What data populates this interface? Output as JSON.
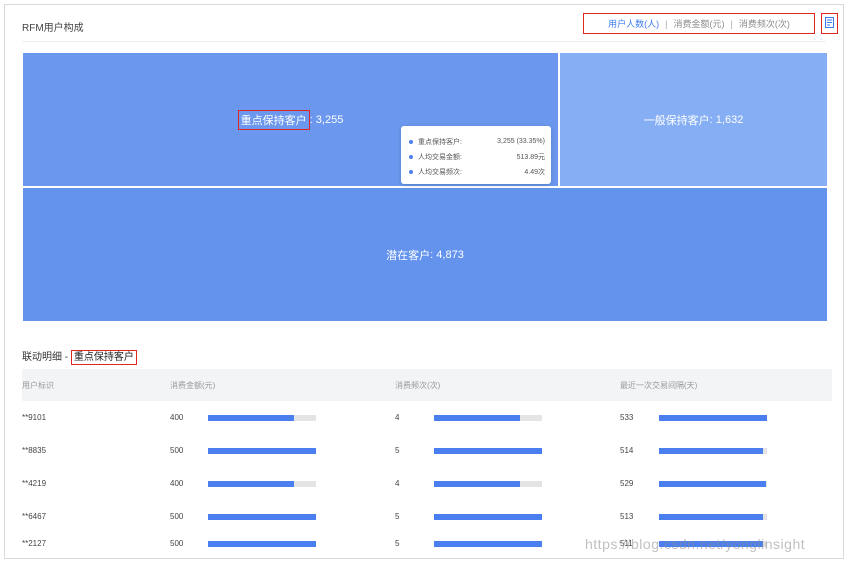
{
  "panel": {
    "title": "RFM用户构成",
    "metrics": [
      "用户人数(人)",
      "消费金额(元)",
      "消费频次(次)"
    ],
    "separator": "|",
    "active_metric_index": 0
  },
  "treemap": {
    "segments": [
      {
        "name": "重点保持客户",
        "value_text": ": 3,255",
        "value": 3255,
        "color": "#6b98ee"
      },
      {
        "name": "一般保持客户",
        "value_text": ": 1,632",
        "value": 1632,
        "color": "#85aef5"
      },
      {
        "name": "潜在客户",
        "value_text": ": 4,873",
        "value": 4873,
        "color": "#6393ed"
      }
    ],
    "tooltip": [
      {
        "key": "重点保持客户:",
        "val": "3,255 (33.35%)"
      },
      {
        "key": "人均交易金额:",
        "val": "513.89元"
      },
      {
        "key": "人均交易频次:",
        "val": "4.49次"
      }
    ]
  },
  "detail": {
    "prefix": "联动明细 - ",
    "segment": "重点保持客户",
    "columns": [
      "用户标识",
      "消费金额(元)",
      "消费频次(次)",
      "最近一次交易间隔(天)"
    ],
    "rows": [
      {
        "id": "**9101",
        "amount": "400",
        "amount_pct": 0.8,
        "freq": "4",
        "freq_pct": 0.8,
        "recency": "533",
        "recency_pct": 1.0
      },
      {
        "id": "**8835",
        "amount": "500",
        "amount_pct": 1.0,
        "freq": "5",
        "freq_pct": 1.0,
        "recency": "514",
        "recency_pct": 0.96
      },
      {
        "id": "**4219",
        "amount": "400",
        "amount_pct": 0.8,
        "freq": "4",
        "freq_pct": 0.8,
        "recency": "529",
        "recency_pct": 0.99
      },
      {
        "id": "**6467",
        "amount": "500",
        "amount_pct": 1.0,
        "freq": "5",
        "freq_pct": 1.0,
        "recency": "513",
        "recency_pct": 0.96
      },
      {
        "id": "**2127",
        "amount": "500",
        "amount_pct": 1.0,
        "freq": "5",
        "freq_pct": 1.0,
        "recency": "511",
        "recency_pct": 0.96
      }
    ]
  },
  "watermark": "https://blog.csdn.net/yonglinsight"
}
